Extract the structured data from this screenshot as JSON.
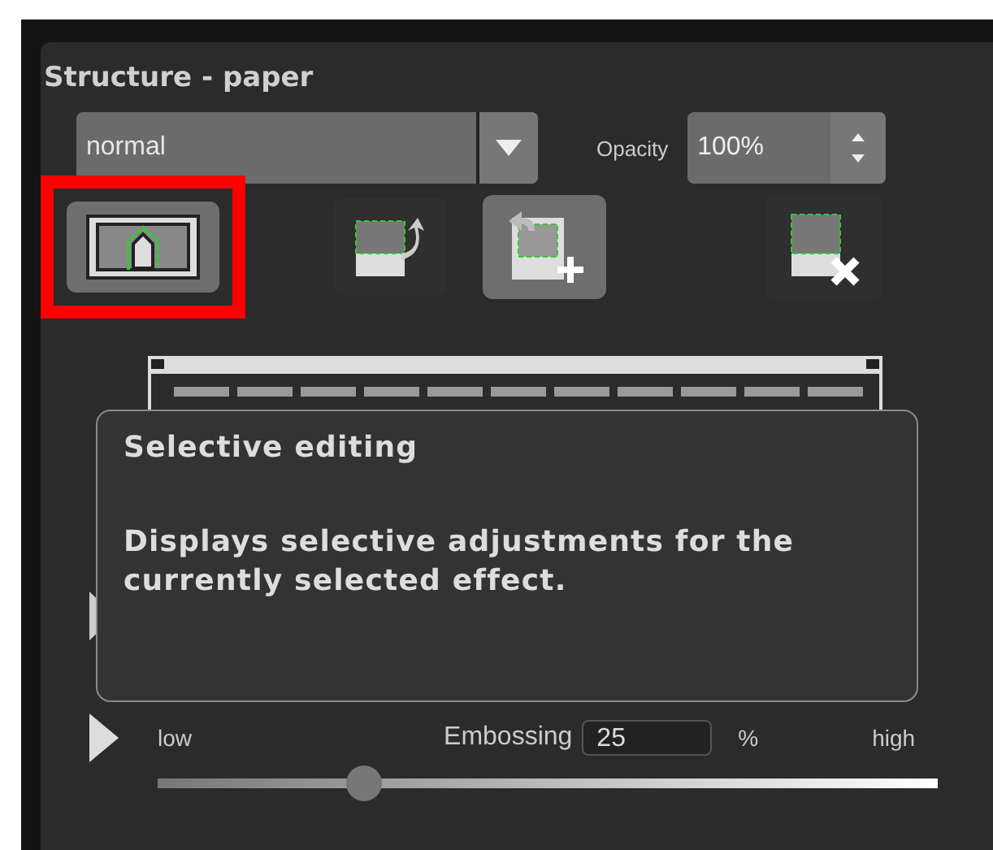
{
  "panel": {
    "title": "Structure - paper"
  },
  "blend_mode": {
    "value": "normal"
  },
  "opacity": {
    "label": "Opacity",
    "value": "100%"
  },
  "toolbar": [
    {
      "kind": "selective",
      "selected": true,
      "highlighted": true
    },
    {
      "kind": "rotate",
      "selected": false,
      "highlighted": false
    },
    {
      "kind": "add",
      "selected": true,
      "highlighted": false
    },
    {
      "kind": "remove",
      "selected": false,
      "highlighted": false
    }
  ],
  "tooltip": {
    "title": "Selective editing",
    "text": "Displays selective adjustments for the currently selected effect."
  },
  "slider": {
    "min_label": "low",
    "label": "Embossing",
    "value": "25",
    "unit": "%",
    "max_label": "high",
    "level": 0.265
  }
}
